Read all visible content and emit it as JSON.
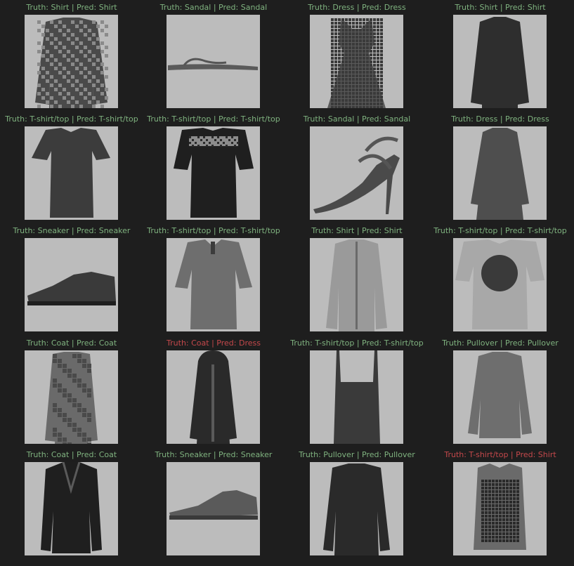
{
  "colors": {
    "background": "#1e1e1e",
    "correct": "#7fb27f",
    "wrong": "#c4484b",
    "image_bg": "#bcbcbc"
  },
  "grid": {
    "columns": 4,
    "cells": [
      {
        "truth": "Shirt",
        "pred": "Shirt",
        "icon": "patterned-shirt-icon"
      },
      {
        "truth": "Sandal",
        "pred": "Sandal",
        "icon": "flip-flop-sandal-icon"
      },
      {
        "truth": "Dress",
        "pred": "Dress",
        "icon": "patterned-dress-icon"
      },
      {
        "truth": "Shirt",
        "pred": "Shirt",
        "icon": "dark-long-sleeve-shirt-icon"
      },
      {
        "truth": "T-shirt/top",
        "pred": "T-shirt/top",
        "icon": "dark-tshirt-icon"
      },
      {
        "truth": "T-shirt/top",
        "pred": "T-shirt/top",
        "icon": "printed-tshirt-icon"
      },
      {
        "truth": "Sandal",
        "pred": "Sandal",
        "icon": "high-heel-sandal-icon"
      },
      {
        "truth": "Dress",
        "pred": "Dress",
        "icon": "long-sleeve-dress-icon"
      },
      {
        "truth": "Sneaker",
        "pred": "Sneaker",
        "icon": "dark-sneaker-icon"
      },
      {
        "truth": "T-shirt/top",
        "pred": "T-shirt/top",
        "icon": "polo-shirt-icon"
      },
      {
        "truth": "Shirt",
        "pred": "Shirt",
        "icon": "light-button-shirt-icon"
      },
      {
        "truth": "T-shirt/top",
        "pred": "T-shirt/top",
        "icon": "graphic-tshirt-icon"
      },
      {
        "truth": "Coat",
        "pred": "Coat",
        "icon": "trench-coat-icon"
      },
      {
        "truth": "Coat",
        "pred": "Dress",
        "icon": "dark-hooded-coat-icon"
      },
      {
        "truth": "T-shirt/top",
        "pred": "T-shirt/top",
        "icon": "tank-top-icon"
      },
      {
        "truth": "Pullover",
        "pred": "Pullover",
        "icon": "gray-pullover-icon"
      },
      {
        "truth": "Coat",
        "pred": "Coat",
        "icon": "leather-jacket-icon"
      },
      {
        "truth": "Sneaker",
        "pred": "Sneaker",
        "icon": "low-sneaker-icon"
      },
      {
        "truth": "Pullover",
        "pred": "Pullover",
        "icon": "dark-pullover-icon"
      },
      {
        "truth": "T-shirt/top",
        "pred": "Shirt",
        "icon": "patterned-top-icon"
      }
    ]
  }
}
